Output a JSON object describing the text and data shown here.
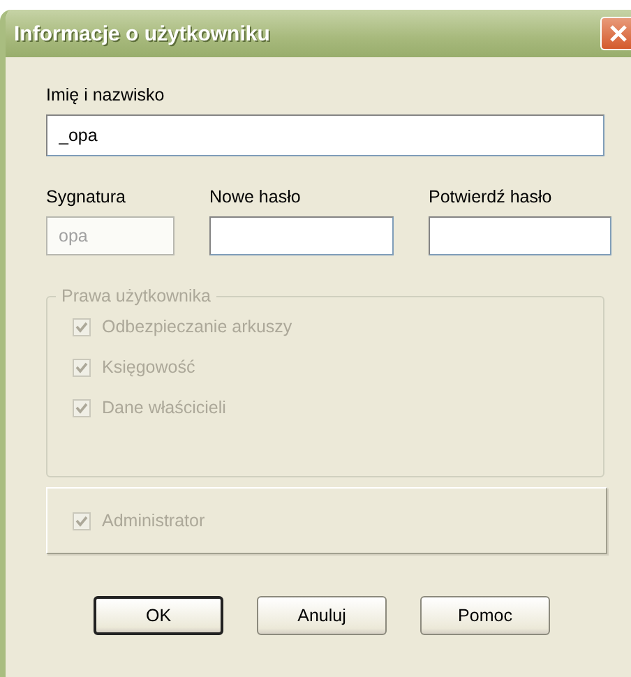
{
  "window": {
    "title": "Informacje o użytkowniku"
  },
  "name_field": {
    "label": "Imię i nazwisko",
    "value": "_opa",
    "disabled": false
  },
  "fields": [
    {
      "label": "Sygnatura",
      "value": "opa",
      "disabled": true
    },
    {
      "label": "Nowe hasło",
      "disabled": false
    },
    {
      "label": "Potwierdź hasło",
      "disabled": false
    }
  ],
  "rights_group": {
    "title": "Prawa użytkownika",
    "disabled": true,
    "options": [
      {
        "label": "Odbezpieczanie arkuszy",
        "checked": true,
        "disabled": true
      },
      {
        "label": "Księgowość",
        "checked": true,
        "disabled": true
      },
      {
        "label": "Dane właścicieli",
        "checked": true,
        "disabled": true
      }
    ]
  },
  "admin": {
    "label": "Administrator",
    "checked": true,
    "disabled": true
  },
  "buttons": [
    {
      "label": "OK",
      "default": true
    },
    {
      "label": "Anuluj",
      "default": false
    },
    {
      "label": "Pomoc",
      "default": false
    }
  ]
}
